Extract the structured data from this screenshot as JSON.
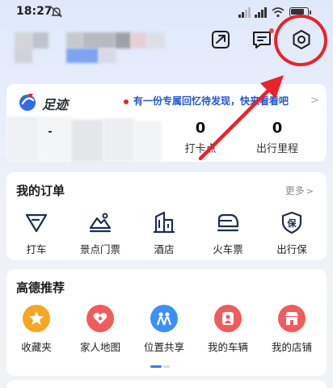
{
  "status_bar": {
    "time": "18:27",
    "battery_level": 0.85
  },
  "header": {
    "icons": [
      "send-icon",
      "message-icon",
      "settings-icon"
    ]
  },
  "footprint": {
    "title": "足迹",
    "banner": "有一份专属回忆待发现，快来看看吧",
    "chevron": ">",
    "stats": [
      {
        "value": "0",
        "label": "打卡点"
      },
      {
        "value": "0",
        "label": "出行里程"
      }
    ]
  },
  "orders": {
    "title": "我的订单",
    "more": "更多",
    "more_chevron": ">",
    "items": [
      {
        "label": "打车",
        "icon": "taxi-icon"
      },
      {
        "label": "景点门票",
        "icon": "scenic-ticket-icon"
      },
      {
        "label": "酒店",
        "icon": "hotel-icon"
      },
      {
        "label": "火车票",
        "icon": "train-icon"
      },
      {
        "label": "出行保",
        "icon": "insurance-icon"
      }
    ]
  },
  "recommend": {
    "title": "高德推荐",
    "items": [
      {
        "label": "收藏夹",
        "icon": "star-icon",
        "color": "#f5a623"
      },
      {
        "label": "家人地图",
        "icon": "family-heart-icon",
        "color": "#f25b5b"
      },
      {
        "label": "位置共享",
        "icon": "people-share-icon",
        "color": "#3d8ff5"
      },
      {
        "label": "我的车辆",
        "icon": "car-person-icon",
        "color": "#f25b5b"
      },
      {
        "label": "我的店铺",
        "icon": "shop-icon",
        "color": "#f25b5b"
      }
    ]
  },
  "colors": {
    "accent_blue": "#2257d6",
    "annotation_red": "#e8232a"
  }
}
